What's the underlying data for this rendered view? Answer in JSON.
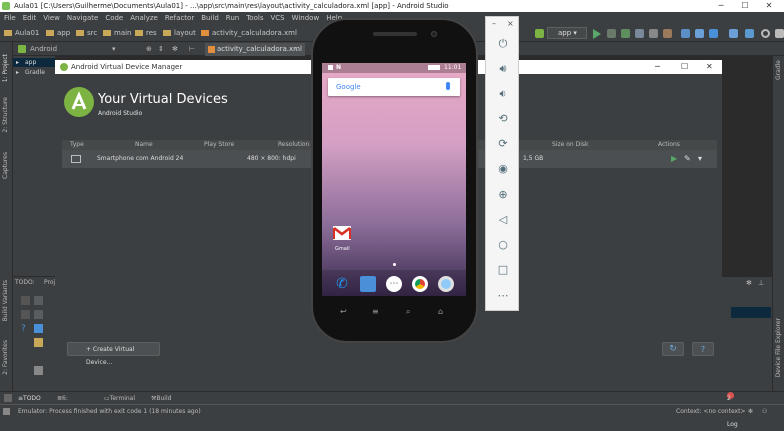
{
  "window": {
    "title": "Aula01 [C:\\Users\\Guilherme\\Documents\\Aula01] - ...\\app\\src\\main\\res\\layout\\activity_calculadora.xml [app] - Android Studio",
    "minimize": "─",
    "maximize": "☐",
    "close": "✕"
  },
  "menu": [
    "File",
    "Edit",
    "View",
    "Navigate",
    "Code",
    "Analyze",
    "Refactor",
    "Build",
    "Run",
    "Tools",
    "VCS",
    "Window",
    "Help"
  ],
  "breadcrumb": [
    "Aula01",
    "app",
    "src",
    "main",
    "res",
    "layout",
    "activity_calculadora.xml"
  ],
  "toolbar": {
    "run_config": "app"
  },
  "project_selector": "Android",
  "editor_tab": "activity_calculadora.xml",
  "project_tree": {
    "item1": "app",
    "item2": "Gradle"
  },
  "side_tabs": {
    "project": "1: Project",
    "structure": "2: Structure",
    "captures": "Captures",
    "build_variants": "Build Variants",
    "favorites": "2: Favorites",
    "gradle": "Gradle",
    "device_explorer": "Device File Explorer"
  },
  "avd_manager": {
    "window_title": "Android Virtual Device Manager",
    "heading": "Your Virtual Devices",
    "subheading": "Android Studio",
    "columns": [
      "Type",
      "Name",
      "Play Store",
      "Resolution",
      "Size on Disk",
      "Actions"
    ],
    "rows": [
      {
        "name": "Smartphone com Android 24",
        "resolution": "480 × 800: hdpi",
        "size": "1,5 GB"
      }
    ],
    "create_button": "+ Create Virtual Device...",
    "refresh_icon": "↻",
    "help_icon": "?"
  },
  "todo": {
    "label": "TODO:",
    "tab": "Proj"
  },
  "emulator": {
    "time": "11:01",
    "search_logo": "Google",
    "app_label": "Gmail",
    "toolbar_minimize": "–",
    "toolbar_close": "×"
  },
  "bottom_tabs": [
    "TODO",
    "6: Logcat",
    "Terminal",
    "Build"
  ],
  "event_log": "2 Event Log",
  "status": {
    "message": "Emulator: Process finished with exit code 1 (18 minutes ago)",
    "context": "Context: <no context>"
  },
  "colors": {
    "accent": "#78c257",
    "editor_bg": "#2b2b2b",
    "panel_bg": "#3c3f41"
  }
}
